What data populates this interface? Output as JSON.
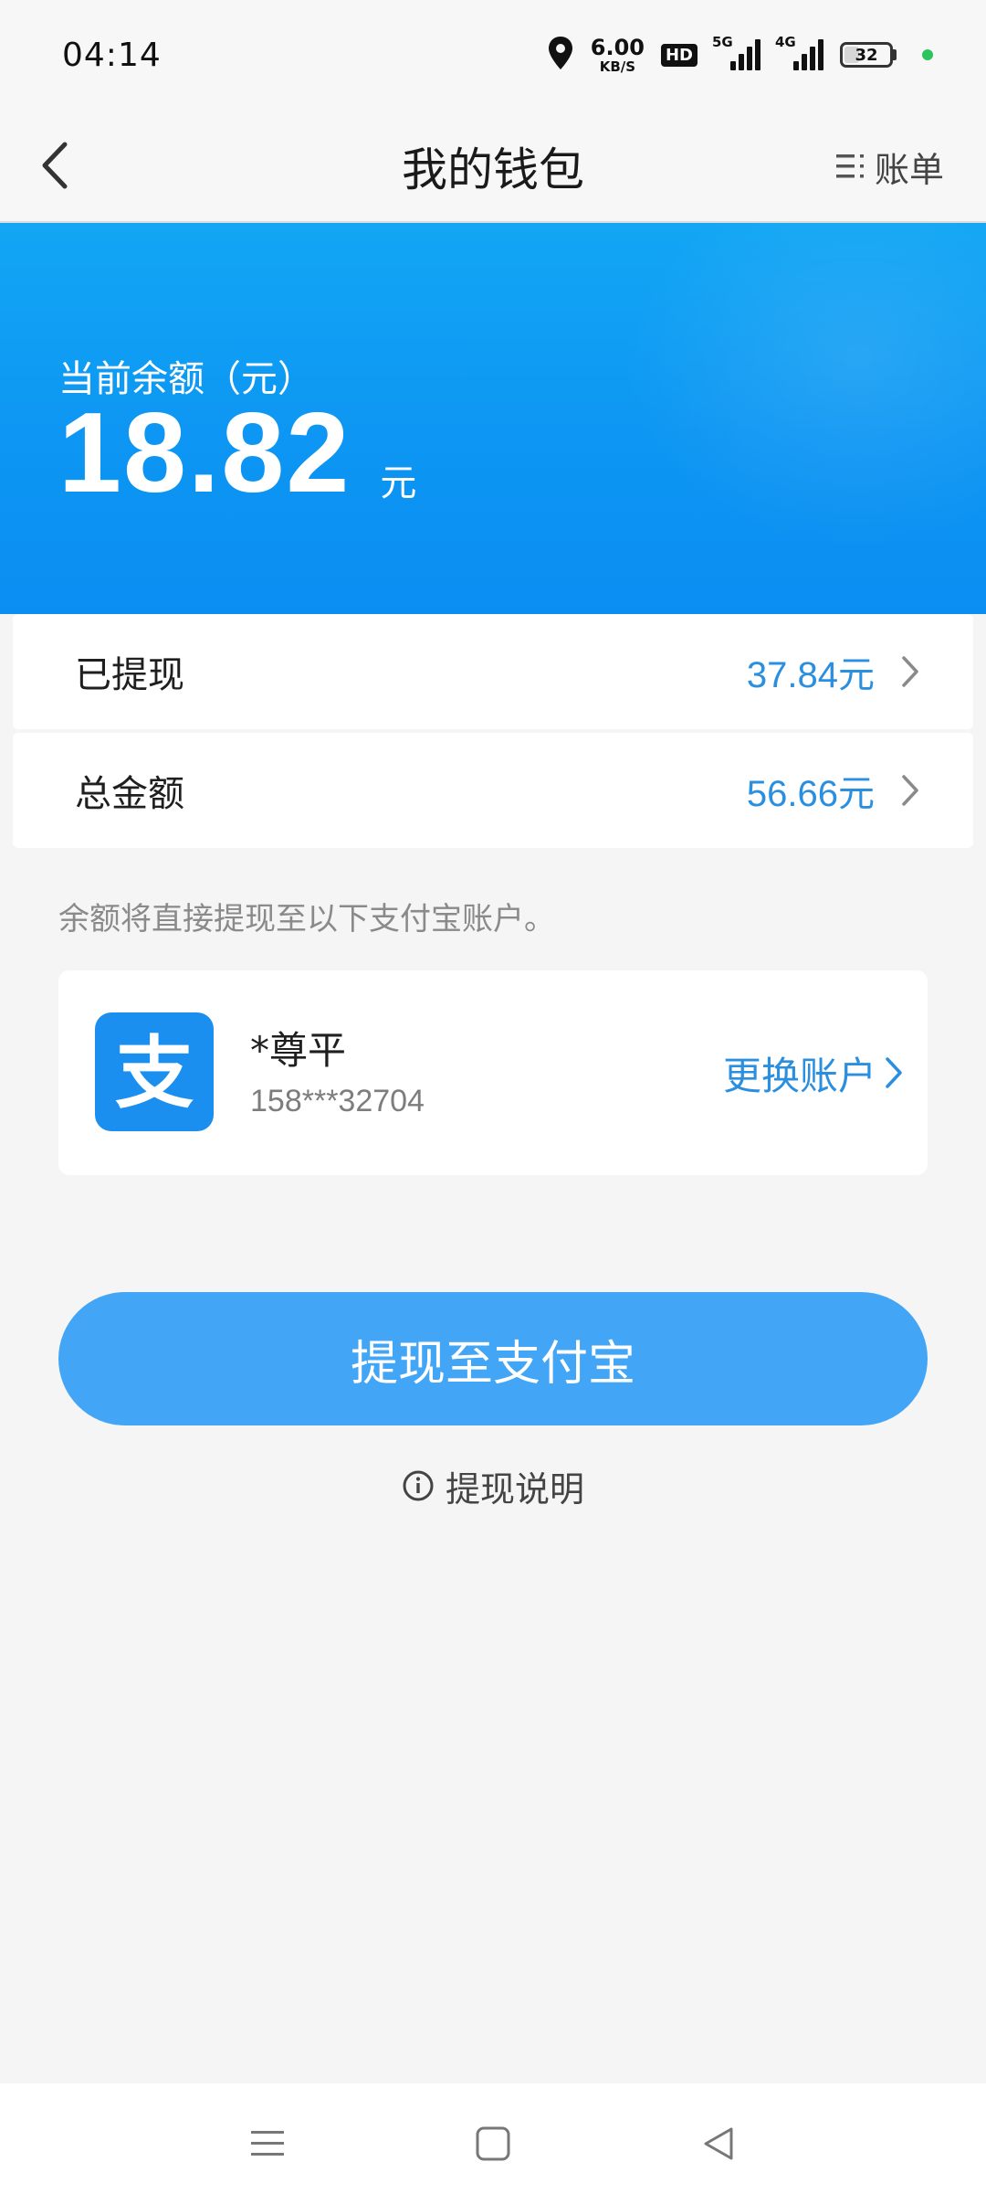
{
  "status_bar": {
    "time": "04:14",
    "net_speed_value": "6.00",
    "net_speed_unit": "KB/S",
    "hd_label": "HD",
    "signal1_label": "5G",
    "signal2_label": "4G",
    "battery_level": "32"
  },
  "header": {
    "title": "我的钱包",
    "bill_label": "账单"
  },
  "balance": {
    "label": "当前余额（元）",
    "amount": "18.82",
    "unit": "元"
  },
  "rows": [
    {
      "label": "已提现",
      "value": "37.84元"
    },
    {
      "label": "总金额",
      "value": "56.66元"
    }
  ],
  "note": "余额将直接提现至以下支付宝账户。",
  "account": {
    "logo_char": "支",
    "name": "*尊平",
    "phone": "158***32704",
    "change_label": "更换账户"
  },
  "withdraw_button": "提现至支付宝",
  "help_link": "提现说明",
  "colors": {
    "hero_blue": "#0d96f3",
    "accent_blue": "#2b8fe0",
    "button_blue": "#42a5f5",
    "background": "#f5f5f5"
  }
}
